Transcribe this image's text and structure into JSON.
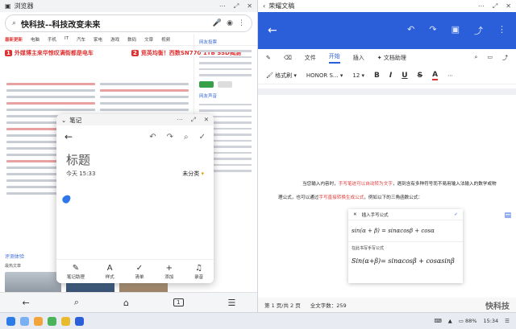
{
  "browser": {
    "title": "浏览器",
    "search_query": "快科技--科技改变未来",
    "nav": [
      "最新更新",
      "电脑",
      "手机",
      "IT",
      "汽车",
      "家电",
      "游戏",
      "数码",
      "文章",
      "视频"
    ],
    "headline_left": "外媒博主来华惊叹满街都是电车",
    "headline_right": "竞英均衡！西数SN770 1TB SSD揭测",
    "headline_left_no": "1",
    "headline_right_no": "2",
    "side_title": "网友投票",
    "side_title2": "网友声音",
    "section_title": "评测体验",
    "section_sub": "最热文章",
    "bottom_nav": [
      "back-icon",
      "search-icon",
      "home-icon",
      "tabs-icon",
      "menu-icon"
    ],
    "tab_count": "1"
  },
  "notes": {
    "title": "笔记",
    "doc_title": "标题",
    "time": "今天 15:33",
    "category": "未分类",
    "toolbar": [
      {
        "icon": "pen-icon",
        "glyph": "✎",
        "label": "笔记助理"
      },
      {
        "icon": "text-style-icon",
        "glyph": "A",
        "label": "样式"
      },
      {
        "icon": "checklist-icon",
        "glyph": "✓",
        "label": "清单"
      },
      {
        "icon": "add-icon",
        "glyph": "+",
        "label": "添加"
      },
      {
        "icon": "record-icon",
        "glyph": "♫",
        "label": "录音"
      }
    ]
  },
  "doc": {
    "app_title": "荣耀文稿",
    "tabs": [
      "文件",
      "开始",
      "插入",
      "文档助理"
    ],
    "active_tab": "开始",
    "format_brush": "格式刷",
    "font_name": "HONOR S...",
    "font_size": "12",
    "paragraph_pre": "当您输入内容时，",
    "paragraph_hl1": "手写笔迹可以自动转为文字",
    "paragraph_mid": "，遇到含有多种符号而不易用输入法输入的数学或物理公式，也可以通过",
    "paragraph_hl2": "手写直接转换生成公式",
    "paragraph_end": "，例如以下的三角函数公式：",
    "formula_title": "插入手写公式",
    "formula_eq": "sin(α + β) = sinαcosβ + cosα",
    "formula_sub": "在此书写手写公式",
    "formula_hand": "Sin(α+β)= sinαcosβ + cosαsinβ",
    "page_info": "第 1 页/共 2 页",
    "word_count": "全文字数：259",
    "watermark": "快科技"
  },
  "taskbar": {
    "wifi": "▲",
    "battery": "88%",
    "time": "15:34"
  }
}
